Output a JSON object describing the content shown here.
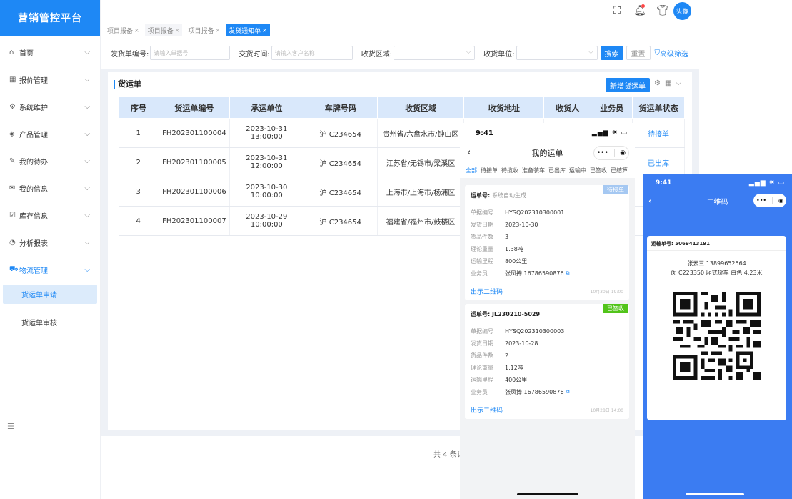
{
  "app": {
    "title": "营销管控平台"
  },
  "sidebar": {
    "items": [
      {
        "icon": "⌂",
        "label": "首页"
      },
      {
        "icon": "▦",
        "label": "报价管理"
      },
      {
        "icon": "⚙",
        "label": "系统维护"
      },
      {
        "icon": "◈",
        "label": "产品管理"
      },
      {
        "icon": "✎",
        "label": "我的待办"
      },
      {
        "icon": "✉",
        "label": "我的信息"
      },
      {
        "icon": "☑",
        "label": "库存信息"
      },
      {
        "icon": "◔",
        "label": "分析报表"
      },
      {
        "icon": "⛟",
        "label": "物流管理"
      }
    ],
    "sub_items": [
      {
        "label": "货运单申请"
      },
      {
        "label": "货运单审核"
      }
    ]
  },
  "header": {
    "avatar_label": "头像"
  },
  "tabs": [
    {
      "label": "项目报备"
    },
    {
      "label": "项目报备"
    },
    {
      "label": "项目报备"
    },
    {
      "label": "发货通知单"
    }
  ],
  "filter": {
    "fields": [
      {
        "label": "发货单编号:",
        "placeholder": "请输入单据号"
      },
      {
        "label": "交货时间:",
        "placeholder": "请输入客户名称"
      },
      {
        "label": "收货区域:",
        "placeholder": ""
      },
      {
        "label": "收货单位:",
        "placeholder": ""
      }
    ],
    "search_label": "搜索",
    "reset_label": "重置",
    "advanced_label": "高级筛选"
  },
  "panel": {
    "title": "货运单",
    "add_label": "新增货运单",
    "pager_text": "共 4 条记"
  },
  "table": {
    "headers": [
      "序号",
      "货运单编号",
      "承运单位",
      "车牌号码",
      "收货区域",
      "收货地址",
      "收货人",
      "业务员",
      "货运单状态"
    ],
    "rows": [
      {
        "no": "1",
        "code": "FH202301100004",
        "carrier": "2023-10-31 13:00:00",
        "plate": "沪 C234654",
        "region": "贵州省/六盘水市/钟山区",
        "status": "待接单"
      },
      {
        "no": "2",
        "code": "FH202301100005",
        "carrier": "2023-10-31 12:00:00",
        "plate": "沪 C234654",
        "region": "江苏省/无锡市/梁溪区",
        "status": "已出库"
      },
      {
        "no": "3",
        "code": "FH202301100006",
        "carrier": "2023-10-30 10:00:00",
        "plate": "沪 C234654",
        "region": "上海市/上海市/杨浦区",
        "status": ""
      },
      {
        "no": "4",
        "code": "FH202301100007",
        "carrier": "2023-10-29 10:00:00",
        "plate": "沪 C234654",
        "region": "福建省/福州市/鼓楼区",
        "status": ""
      }
    ]
  },
  "phone1": {
    "time": "9:41",
    "title": "我的运单",
    "capsule_dots": "•••",
    "filter_tabs": [
      "全部",
      "待接单",
      "待揽收",
      "准备装车",
      "已出库",
      "运输中",
      "已签收",
      "已结算"
    ],
    "cards": [
      {
        "id_label": "运单号:",
        "id_value": "系统自动生成",
        "badge": "待接单",
        "fields": [
          {
            "k": "单据编号",
            "v": "HYSQ202310300001"
          },
          {
            "k": "发货日期",
            "v": "2023-10-30"
          },
          {
            "k": "货品件数",
            "v": "3"
          },
          {
            "k": "理论重量",
            "v": "1.38吨"
          },
          {
            "k": "运输里程",
            "v": "800公里"
          },
          {
            "k": "业务员",
            "v": "张凤捧  16786590876"
          }
        ],
        "qr_link": "出示二维码",
        "time": "10月30日 19:00"
      },
      {
        "id_label": "运单号:",
        "id_value": "JL230210-5029",
        "badge": "已签收",
        "fields": [
          {
            "k": "单据编号",
            "v": "HYSQ202310300003"
          },
          {
            "k": "发货日期",
            "v": "2023-10-28"
          },
          {
            "k": "货品件数",
            "v": "2"
          },
          {
            "k": "理论重量",
            "v": "1.12吨"
          },
          {
            "k": "运输里程",
            "v": "400公里"
          },
          {
            "k": "业务员",
            "v": "张凤捧  16786590876"
          }
        ],
        "qr_link": "出示二维码",
        "time": "10月28日 14:00"
      }
    ]
  },
  "phone2": {
    "time": "9:41",
    "title": "二维码",
    "capsule_dots": "•••",
    "waybill": "运输单号: 5069413191",
    "person": "张云三  13899652564",
    "vehicle": "闵 C223350  厢式货车  白色 4.23米"
  },
  "colors": {
    "primary": "#1e88f5",
    "signed": "#52c41a",
    "pending": "#a5c8f2",
    "phone2_bg": "#3b7cf2"
  }
}
